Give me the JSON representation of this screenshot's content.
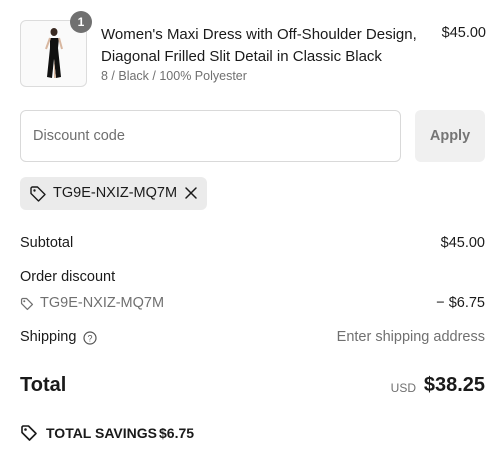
{
  "product": {
    "quantity": "1",
    "name": "Women's Maxi Dress with Off-Shoulder Design, Diagonal Frilled Slit Detail in Classic Black",
    "variant": "8 / Black / 100% Polyester",
    "price": "$45.00"
  },
  "discount": {
    "placeholder": "Discount code",
    "apply_label": "Apply",
    "applied_code": "TG9E-NXIZ-MQ7M"
  },
  "summary": {
    "subtotal_label": "Subtotal",
    "subtotal_value": "$45.00",
    "order_discount_label": "Order discount",
    "discount_code": "TG9E-NXIZ-MQ7M",
    "discount_value": "− $6.75",
    "shipping_label": "Shipping",
    "shipping_value": "Enter shipping address",
    "total_label": "Total",
    "currency": "USD",
    "total_value": "$38.25",
    "savings_label": "TOTAL SAVINGS",
    "savings_value": "$6.75"
  },
  "icons": {
    "tag": "tag-icon",
    "remove": "close-icon",
    "info": "info-icon",
    "savings": "tag-icon"
  },
  "colors": {
    "badge": "#707070",
    "chip_bg": "#ebebeb",
    "muted_text": "#707070",
    "apply_bg": "#f0f0f0"
  }
}
